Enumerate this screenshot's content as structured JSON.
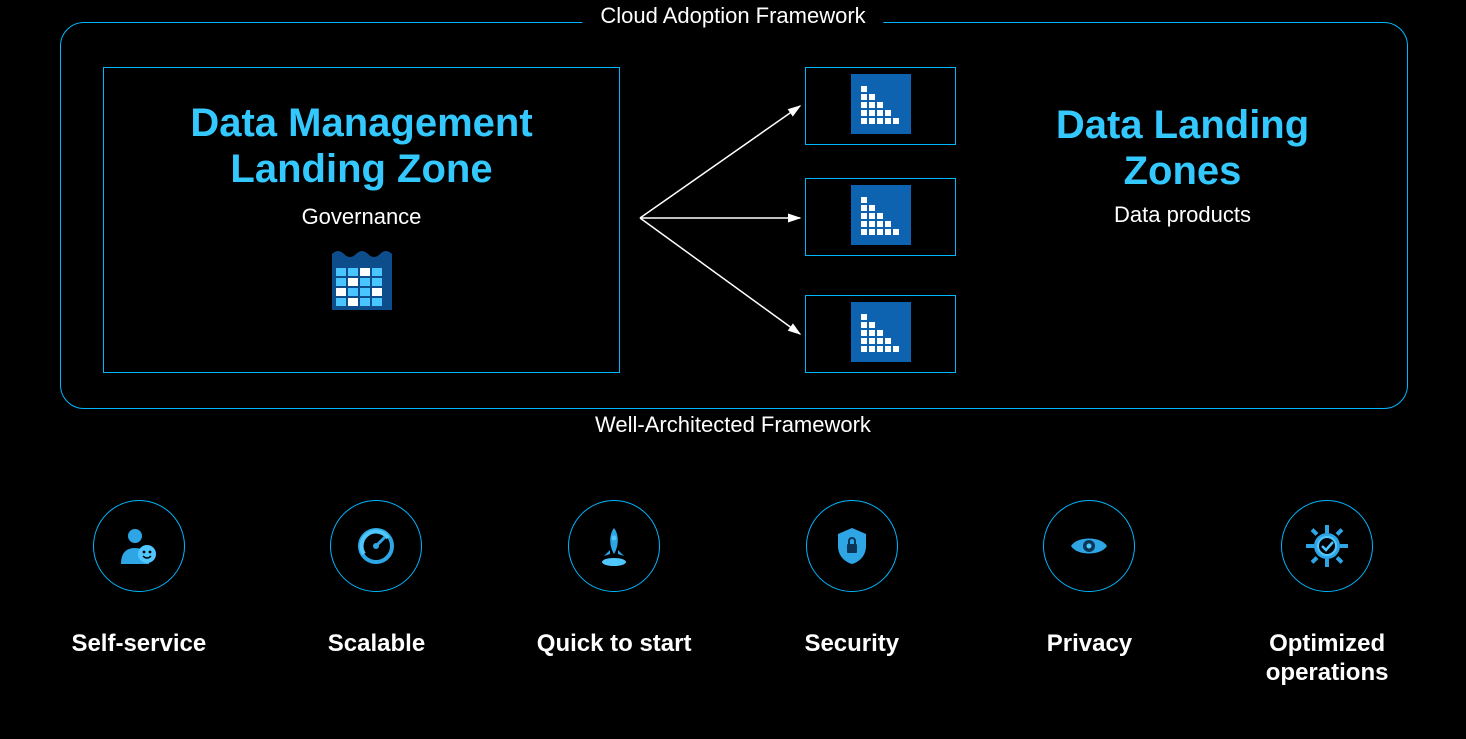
{
  "labels": {
    "top": "Cloud Adoption Framework",
    "bottom": "Well-Architected Framework"
  },
  "mgmt": {
    "title_line1": "Data Management",
    "title_line2": "Landing Zone",
    "subtitle": "Governance"
  },
  "landing": {
    "title_line1": "Data Landing",
    "title_line2": "Zones",
    "subtitle": "Data products"
  },
  "features": [
    {
      "label": "Self-service"
    },
    {
      "label": "Scalable"
    },
    {
      "label": "Quick to start"
    },
    {
      "label": "Security"
    },
    {
      "label": "Privacy"
    },
    {
      "label": "Optimized operations"
    }
  ]
}
